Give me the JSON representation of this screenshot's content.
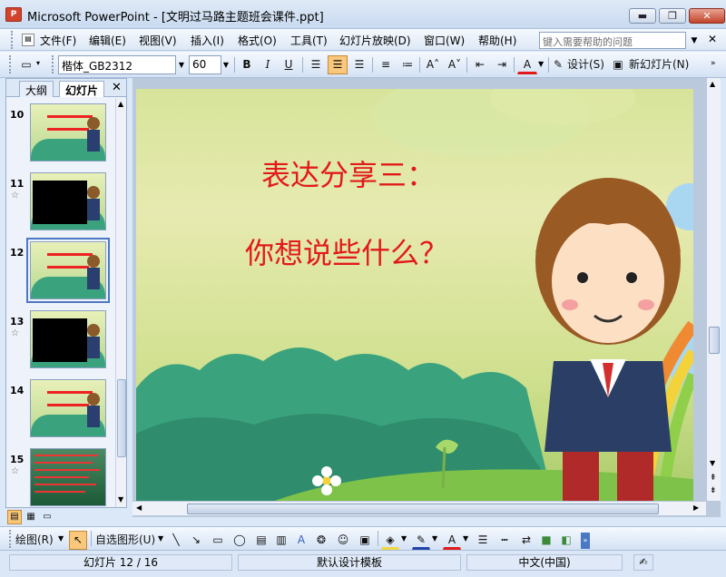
{
  "window": {
    "title": "Microsoft PowerPoint - [文明过马路主题班会课件.ppt]",
    "app_icon_label": "P",
    "minimize": "▬",
    "restore": "❐",
    "close": "✕"
  },
  "menu": [
    "文件(F)",
    "编辑(E)",
    "视图(V)",
    "插入(I)",
    "格式(O)",
    "工具(T)",
    "幻灯片放映(D)",
    "窗口(W)",
    "帮助(H)"
  ],
  "help_search": {
    "placeholder": "键入需要帮助的问题"
  },
  "toolbar": {
    "font_name": "楷体_GB2312",
    "font_size": "60",
    "bold": "B",
    "italic": "I",
    "underline": "U",
    "design_label": "设计(S)",
    "new_slide_label": "新幻灯片(N)"
  },
  "panel": {
    "tabs": [
      "大纲",
      "幻灯片"
    ],
    "close": "✕"
  },
  "thumbnails": [
    {
      "num": "10",
      "star": false
    },
    {
      "num": "11",
      "star": true
    },
    {
      "num": "12",
      "star": false
    },
    {
      "num": "13",
      "star": true
    },
    {
      "num": "14",
      "star": false
    },
    {
      "num": "15",
      "star": true
    }
  ],
  "slide": {
    "title": "表达分享三：",
    "body": "你想说些什么？"
  },
  "drawbar": {
    "draw_label": "绘图(R)",
    "autoshape_label": "自选图形(U)"
  },
  "status": {
    "slide": "幻灯片 12 / 16",
    "design": "默认设计模板",
    "language": "中文(中国)"
  },
  "colors": {
    "title_red": "#e21a1a",
    "accent": "#4a78c2"
  }
}
